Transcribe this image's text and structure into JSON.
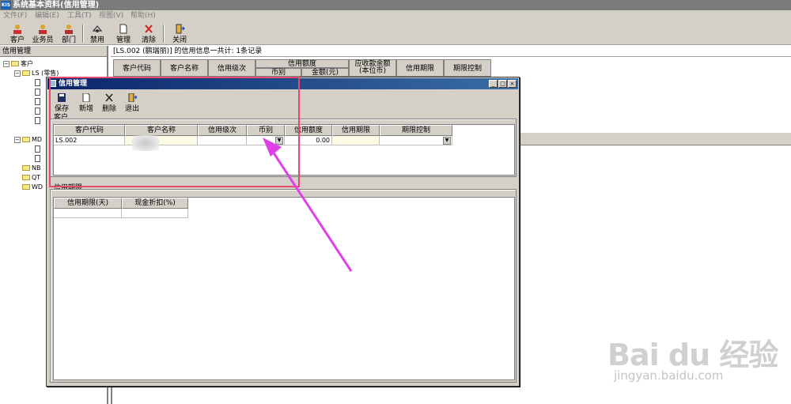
{
  "window": {
    "title": "系统基本资料(信用管理)",
    "logo_text": "KIS"
  },
  "menu": [
    "文件(F)",
    "编辑(E)",
    "工具(T)",
    "视图(V)",
    "帮助(H)"
  ],
  "toolbar": {
    "customer": "客户",
    "salesman": "业务员",
    "department": "部门",
    "disable": "禁用",
    "manage": "管理",
    "clear": "清除",
    "close": "关闭"
  },
  "left_panel": {
    "header": "信用管理",
    "tree": [
      {
        "label": "客户",
        "level": 0
      },
      {
        "label": "LS (零售)",
        "level": 1
      },
      {
        "label": "",
        "level": 2
      },
      {
        "label": "",
        "level": 2
      },
      {
        "label": "",
        "level": 2
      },
      {
        "label": "",
        "level": 2
      },
      {
        "label": "",
        "level": 2
      },
      {
        "label": "MD",
        "level": 1
      },
      {
        "label": "",
        "level": 2
      },
      {
        "label": "",
        "level": 2
      },
      {
        "label": "NB",
        "level": 1
      },
      {
        "label": "QT",
        "level": 1
      },
      {
        "label": "WD",
        "level": 1
      }
    ]
  },
  "right_info": "[LS.002 (鹏瑞丽)] 的信用信息一共计: 1条记录",
  "bg_grid": {
    "headers": [
      "客户代码",
      "客户名称",
      "信用级次",
      "信用额度",
      "币别",
      "金额(元)",
      "应收款余额",
      "(本位币)",
      "信用期限",
      "期限控制"
    ]
  },
  "dialog": {
    "title": "信用管理",
    "toolbar": {
      "save": "保存",
      "add": "新增",
      "delete": "删除",
      "exit": "退出"
    },
    "customer_group": {
      "label": "客户",
      "headers": [
        "客户代码",
        "客户名称",
        "信用级次",
        "币别",
        "信用额度",
        "信用期限",
        "期限控制"
      ],
      "rows": [
        {
          "code": "LS.002",
          "name": "",
          "level": "",
          "currency": "",
          "amount": "0.00",
          "period": "",
          "control": ""
        }
      ]
    },
    "credit_period_group": {
      "label": "信用期限",
      "headers": [
        "信用期限(天)",
        "现金折扣(%)"
      ]
    }
  },
  "watermark": {
    "main": "Bai du 经验",
    "sub": "jingyan.baidu.com"
  }
}
